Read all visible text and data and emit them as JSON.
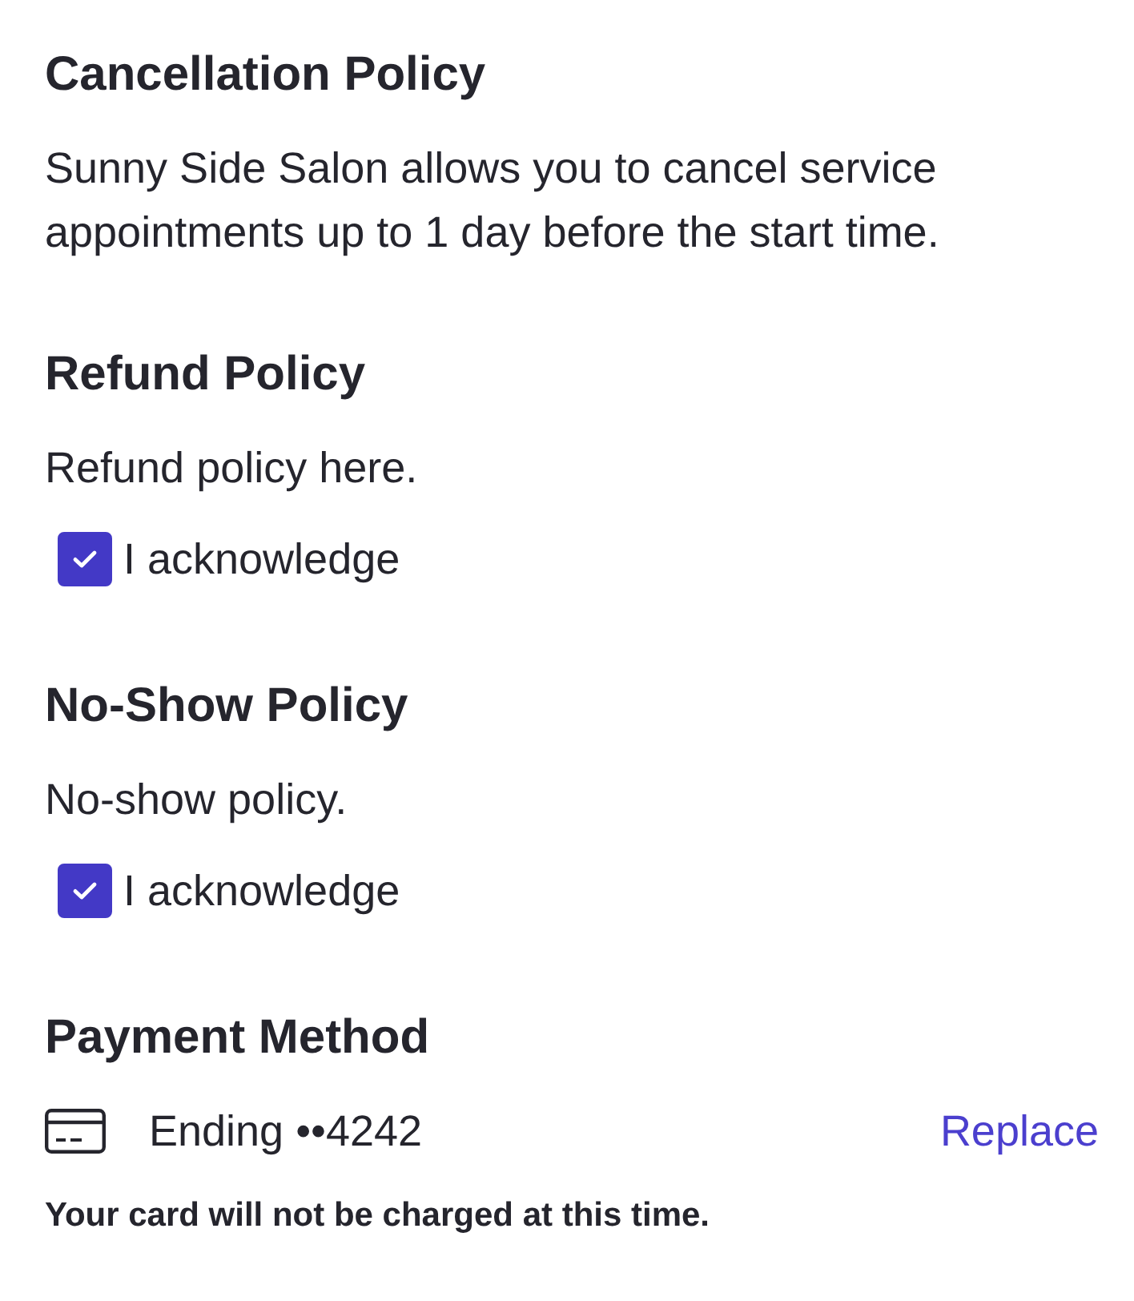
{
  "sections": [
    {
      "kind": "policy",
      "heading": "Cancellation Policy",
      "text": "Sunny Side Salon allows you to cancel service appointments up to 1 day before the start time."
    },
    {
      "kind": "acknowledge",
      "heading": "Refund Policy",
      "text": "Refund policy here.",
      "acknowledgement": {
        "label": "I acknowledge",
        "checked": true
      }
    },
    {
      "kind": "acknowledge",
      "heading": "No-Show Policy",
      "text": "No-show policy.",
      "acknowledgement": {
        "label": "I acknowledge",
        "checked": true
      }
    }
  ],
  "payment": {
    "heading": "Payment Method",
    "card": "Ending ••4242",
    "action": "Replace",
    "note": "Your card will not be charged at this time."
  }
}
